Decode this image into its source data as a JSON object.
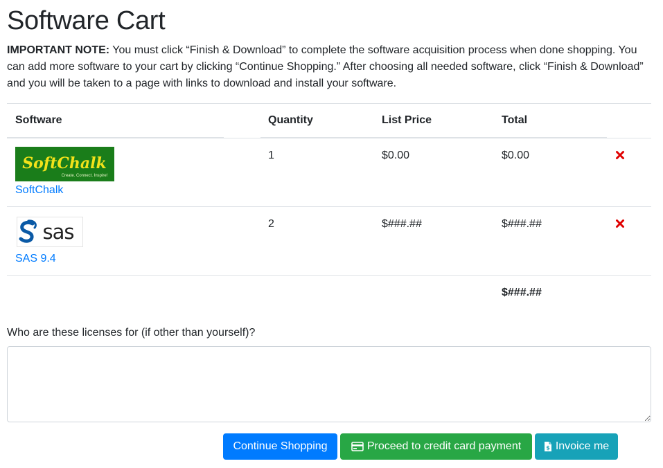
{
  "page": {
    "title": "Software Cart",
    "note_strong": "IMPORTANT NOTE:",
    "note_text": " You must click “Finish & Download” to complete the software acquisition process when done shopping. You can add more software to your cart by clicking “Continue Shopping.” After choosing all needed software, click “Finish & Download” and you will be taken to a page with links to download and install your software."
  },
  "table": {
    "headers": {
      "software": "Software",
      "quantity": "Quantity",
      "list_price": "List Price",
      "total": "Total"
    },
    "rows": [
      {
        "name": "SoftChalk",
        "logo_text": "SoftChalk",
        "logo_tagline": "Create. Connect. Inspire!",
        "quantity": "1",
        "list_price": "$0.00",
        "total": "$0.00"
      },
      {
        "name": "SAS 9.4",
        "logo_text": "sas",
        "quantity": "2",
        "list_price": "$###.##",
        "total": "$###.##"
      }
    ],
    "grand_total": "$###.##"
  },
  "licenses": {
    "label": "Who are these licenses for (if other than yourself)?",
    "value": "",
    "placeholder": ""
  },
  "buttons": {
    "continue": "Continue Shopping",
    "credit_card": "Proceed to credit card payment",
    "invoice": "Invoice me"
  },
  "icons": {
    "remove": "remove-x-icon",
    "credit_card": "credit-card-icon",
    "invoice": "invoice-document-icon"
  },
  "colors": {
    "link": "#007bff",
    "primary": "#007bff",
    "success": "#28a745",
    "info": "#17a2b8",
    "remove": "#e00000",
    "softchalk_bg": "#1a7d1a",
    "softchalk_text": "#f2e21a",
    "sas_blue": "#0b5aa6"
  }
}
